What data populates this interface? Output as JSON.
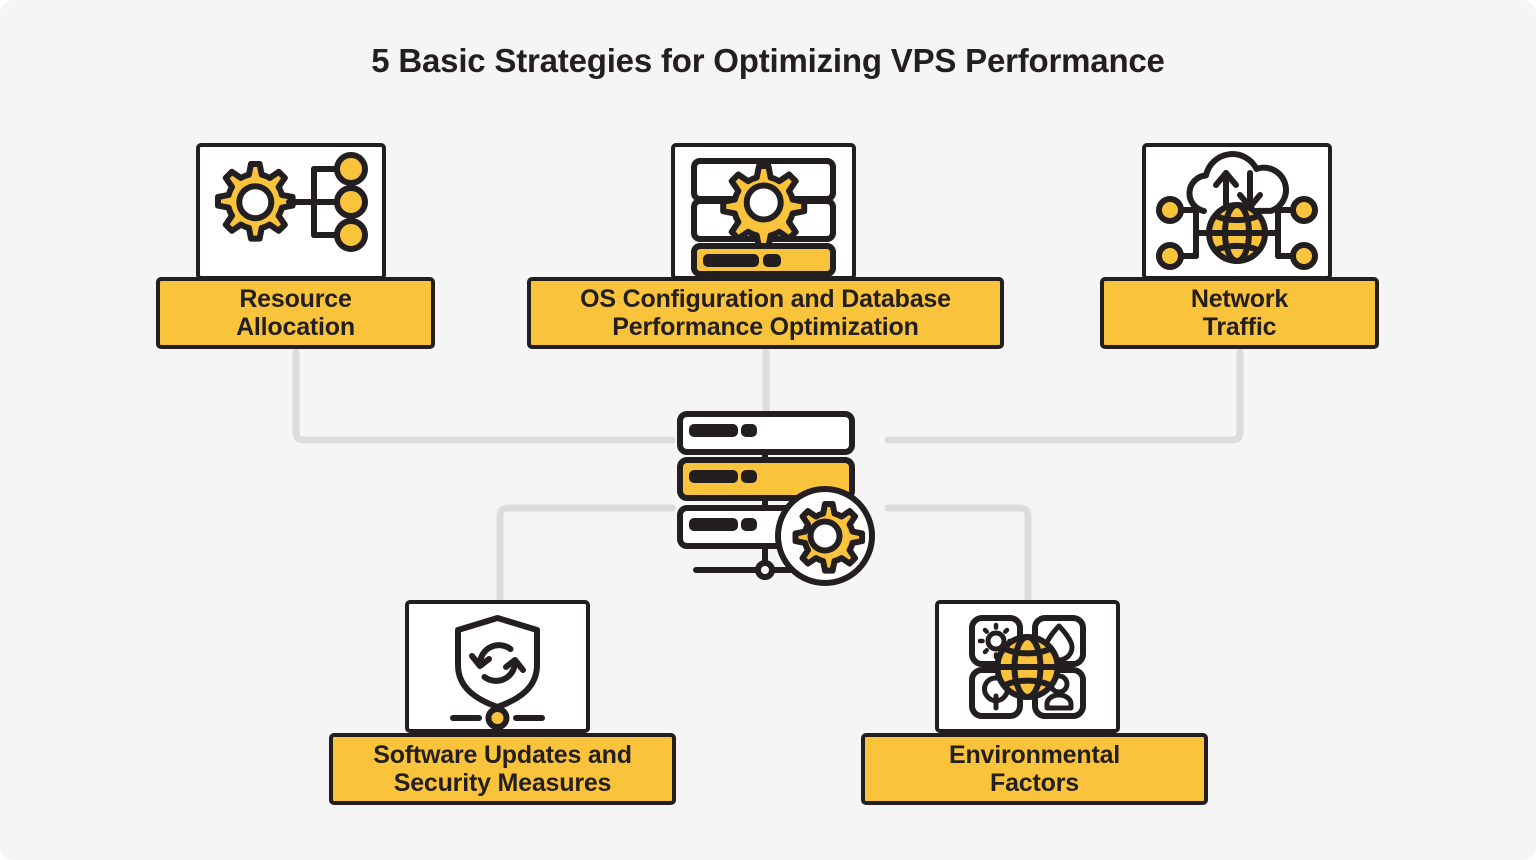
{
  "page": {
    "title": "5 Basic Strategies for Optimizing VPS Performance",
    "background_color": "#f5f5f5",
    "accent_color": "#f9c33c",
    "ink_color": "#231f20",
    "connector_color": "#dcdcdc"
  },
  "center": {
    "name": "vps-server-hub",
    "icon": "server-rack-gear-icon",
    "rack_count": 3,
    "highlighted_rack_index": 1
  },
  "nodes": [
    {
      "id": "resource",
      "label": "Resource\nAllocation",
      "label_line1": "Resource",
      "label_line2": "Allocation",
      "icon": "gear-distribution-tree-icon",
      "position": "top-left"
    },
    {
      "id": "os",
      "label": "OS Configuration and Database\nPerformance Optimization",
      "label_line1": "OS Configuration and Database",
      "label_line2": "Performance Optimization",
      "icon": "server-gear-config-icon",
      "position": "top-center"
    },
    {
      "id": "network",
      "label": "Network\nTraffic",
      "label_line1": "Network",
      "label_line2": "Traffic",
      "icon": "cloud-globe-network-icon",
      "position": "top-right"
    },
    {
      "id": "software",
      "label": "Software Updates and\nSecurity Measures",
      "label_line1": "Software Updates and",
      "label_line2": "Security Measures",
      "icon": "shield-refresh-icon",
      "position": "bottom-left"
    },
    {
      "id": "environment",
      "label": "Environmental\nFactors",
      "label_line1": "Environmental",
      "label_line2": "Factors",
      "icon": "globe-environment-tiles-icon",
      "position": "bottom-right"
    }
  ]
}
